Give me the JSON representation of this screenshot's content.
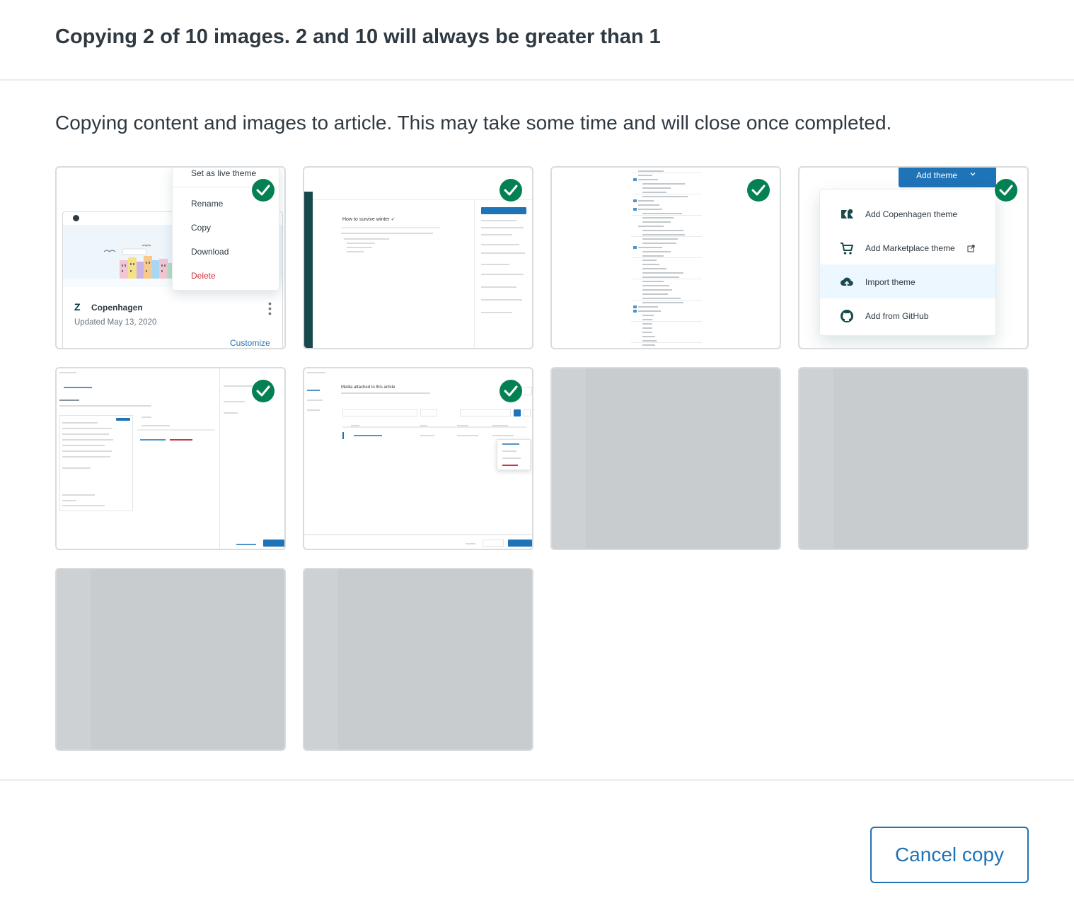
{
  "header": {
    "title": "Copying 2 of 10 images. 2 and 10 will always be greater than 1"
  },
  "description": "Copying content and images to article. This may take some time and will close once completed.",
  "thumbnails": [
    {
      "status": "copied",
      "card": {
        "brand_mark": "Z",
        "name": "Copenhagen",
        "updated": "Updated May 13, 2020",
        "action": "Customize"
      },
      "menu": [
        "Set as live theme",
        "Rename",
        "Copy",
        "Download",
        "Delete"
      ]
    },
    {
      "status": "copied",
      "heading": "How to survive winter ✓"
    },
    {
      "status": "copied"
    },
    {
      "status": "copied",
      "button": "Add theme",
      "menu": [
        {
          "icon": "zendesk-icon",
          "label": "Add Copenhagen theme"
        },
        {
          "icon": "cart-icon",
          "label": "Add Marketplace theme"
        },
        {
          "icon": "cloud-upload-icon",
          "label": "Import theme"
        },
        {
          "icon": "github-icon",
          "label": "Add from GitHub"
        }
      ]
    },
    {
      "status": "copied"
    },
    {
      "status": "copied",
      "heading": "Media attached to this article"
    },
    {
      "status": "pending"
    },
    {
      "status": "pending"
    },
    {
      "status": "pending"
    },
    {
      "status": "pending"
    }
  ],
  "footer": {
    "cancel_label": "Cancel copy"
  },
  "colors": {
    "success": "#038153",
    "primary": "#1f73b7",
    "placeholder": "#c8ccce",
    "danger": "#cc3340"
  }
}
